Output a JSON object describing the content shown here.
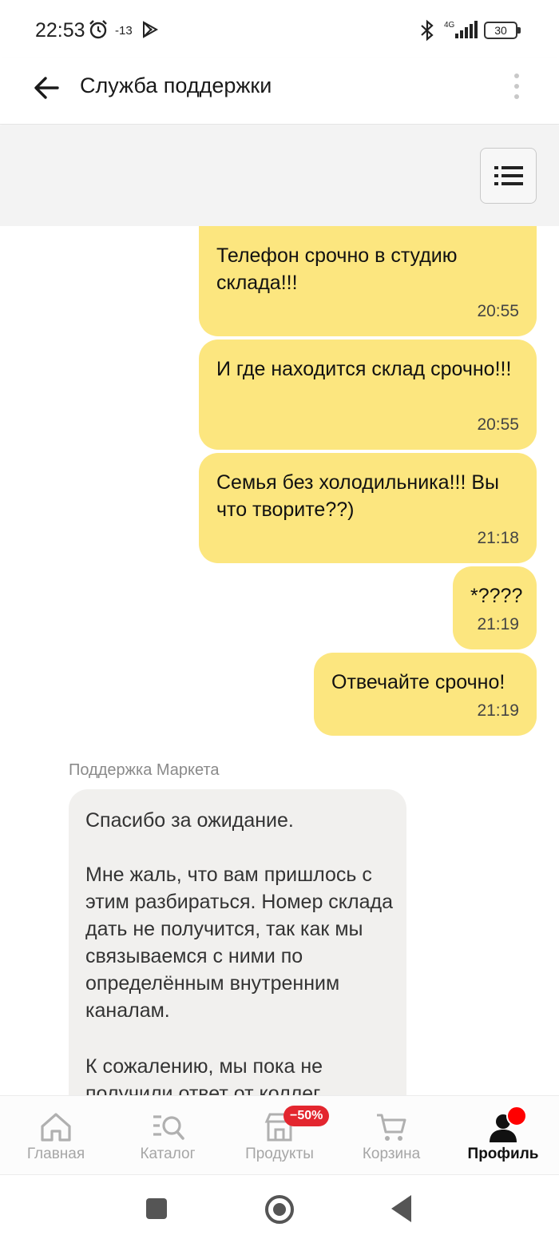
{
  "status_bar": {
    "time": "22:53",
    "temperature": "-13",
    "network": "4G",
    "battery": "30",
    "icons": [
      "alarm-icon",
      "play-icon",
      "bluetooth-icon",
      "signal-icon",
      "battery-icon"
    ]
  },
  "header": {
    "title": "Служба поддержки",
    "back_icon": "arrow-left-icon",
    "more_icon": "more-vertical-icon"
  },
  "toolbar": {
    "menu_icon": "list-icon"
  },
  "chat": {
    "outgoing": [
      {
        "text": "Телефон срочно в студию склада!!!",
        "time": "20:55"
      },
      {
        "text": "И где находится склад срочно!!!",
        "time": "20:55"
      },
      {
        "text": "Семья без холодильника!!! Вы что творите??)",
        "time": "21:18"
      },
      {
        "text": "*????",
        "time": "21:19"
      },
      {
        "text": "Отвечайте срочно!",
        "time": "21:19"
      }
    ],
    "incoming_sender": "Поддержка Маркета",
    "incoming_paragraphs": [
      "Спасибо за ожидание.",
      "Мне жаль, что вам пришлось с этим разбираться. Номер склада дать не получится, так как мы связываемся с ними по определённым внутренним каналам.",
      "К сожалению, мы пока не получили ответ от коллег"
    ]
  },
  "bottom_nav": {
    "items": [
      {
        "label": "Главная",
        "icon": "home-icon"
      },
      {
        "label": "Каталог",
        "icon": "catalog-search-icon"
      },
      {
        "label": "Продукты",
        "icon": "store-icon",
        "badge": "−50%"
      },
      {
        "label": "Корзина",
        "icon": "cart-icon"
      },
      {
        "label": "Профиль",
        "icon": "profile-icon"
      }
    ]
  },
  "colors": {
    "outgoing_bubble": "#fce67f",
    "incoming_bubble": "#f1f0ee",
    "badge": "#e3262f"
  }
}
